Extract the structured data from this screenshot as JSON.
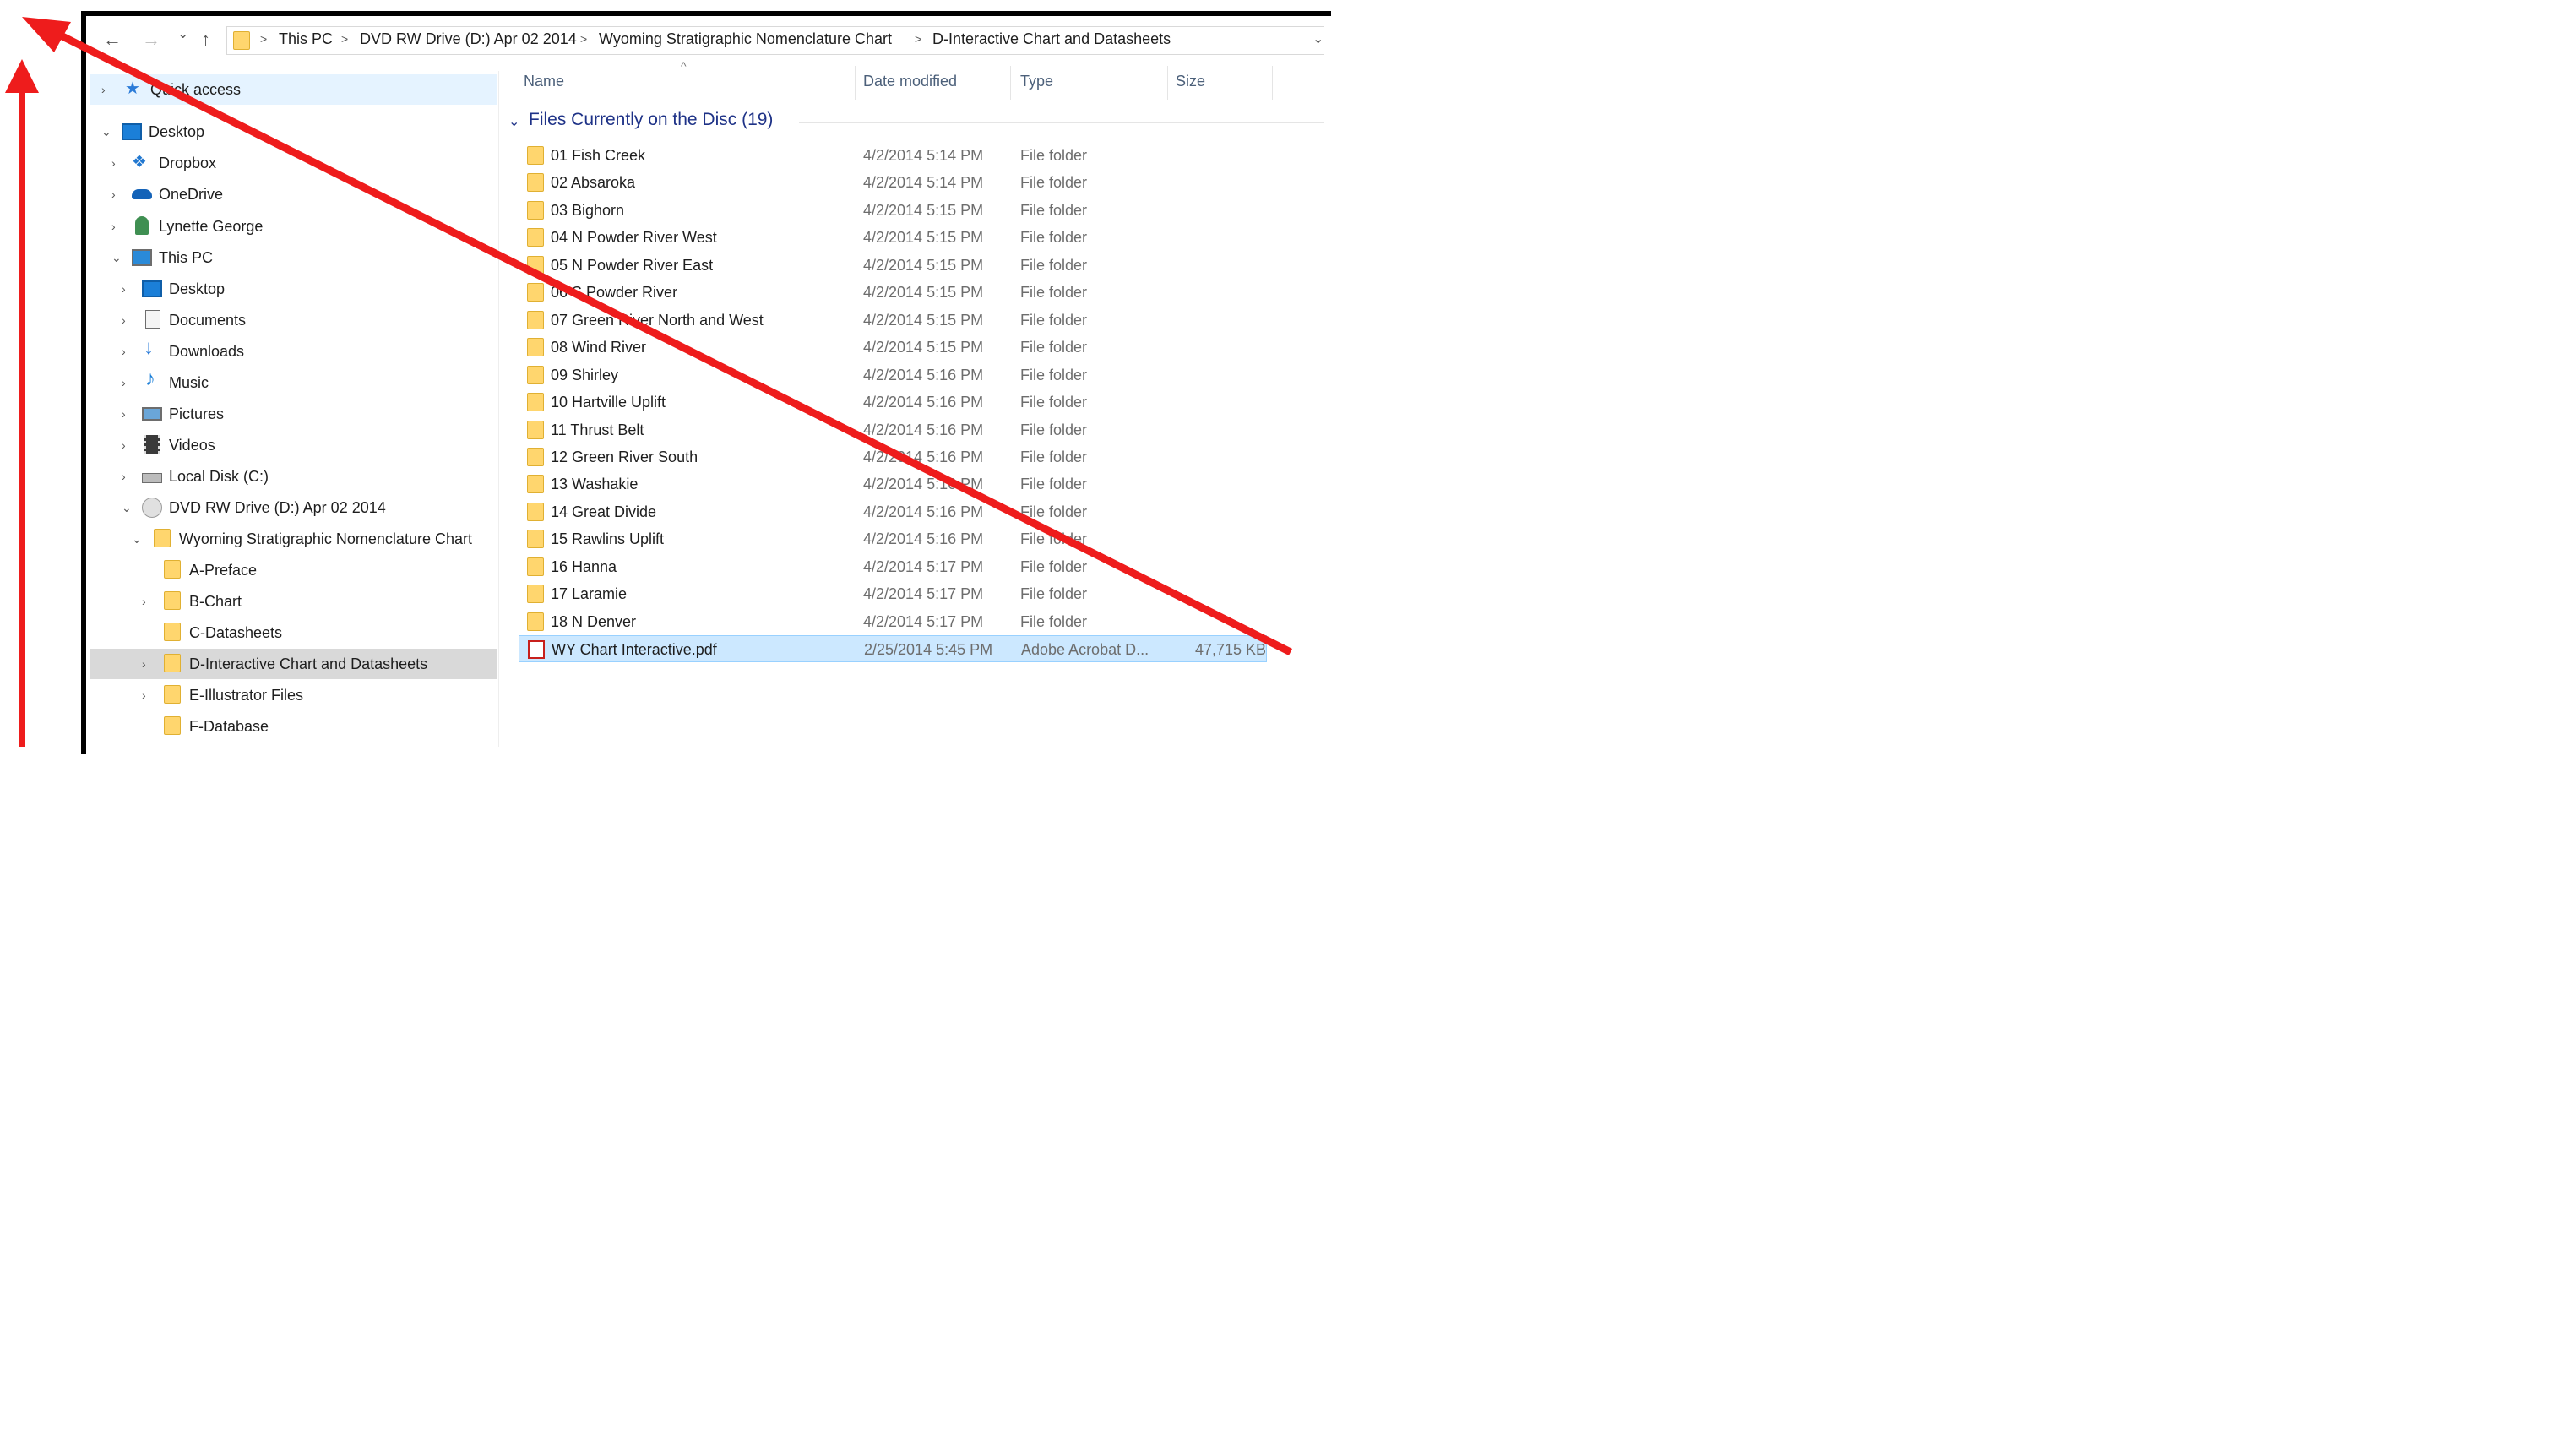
{
  "nav": {
    "back_icon": "←",
    "forward_icon": "→",
    "recent_icon": "⌄",
    "up_icon": "↑",
    "breadcrumb": [
      "This PC",
      "DVD RW Drive (D:) Apr 02 2014",
      "Wyoming Stratigraphic Nomenclature Chart",
      "D-Interactive Chart and Datasheets"
    ],
    "separator": ">",
    "address_dropdown_icon": "⌄"
  },
  "sidebar": {
    "items": [
      {
        "label": "Quick access",
        "icon": "star-icon",
        "chevron": "›"
      },
      {
        "label": "Desktop",
        "icon": "desktop-icon",
        "chevron": "⌄"
      },
      {
        "label": "Dropbox",
        "icon": "dropbox-icon",
        "chevron": "›"
      },
      {
        "label": "OneDrive",
        "icon": "onedrive-icon",
        "chevron": "›"
      },
      {
        "label": "Lynette George",
        "icon": "user-icon",
        "chevron": "›"
      },
      {
        "label": "This PC",
        "icon": "this-pc-icon",
        "chevron": "⌄"
      },
      {
        "label": "Desktop",
        "icon": "desktop-icon",
        "chevron": "›"
      },
      {
        "label": "Documents",
        "icon": "documents-icon",
        "chevron": "›"
      },
      {
        "label": "Downloads",
        "icon": "downloads-icon",
        "chevron": "›"
      },
      {
        "label": "Music",
        "icon": "music-icon",
        "chevron": "›"
      },
      {
        "label": "Pictures",
        "icon": "pictures-icon",
        "chevron": "›"
      },
      {
        "label": "Videos",
        "icon": "videos-icon",
        "chevron": "›"
      },
      {
        "label": "Local Disk (C:)",
        "icon": "local-disk-icon",
        "chevron": "›"
      },
      {
        "label": "DVD RW Drive (D:) Apr 02 2014",
        "icon": "dvd-drive-icon",
        "chevron": "⌄"
      },
      {
        "label": "Wyoming Stratigraphic Nomenclature Chart",
        "icon": "folder-icon",
        "chevron": "⌄"
      },
      {
        "label": "A-Preface",
        "icon": "folder-icon",
        "chevron": ""
      },
      {
        "label": "B-Chart",
        "icon": "folder-icon",
        "chevron": "›"
      },
      {
        "label": "C-Datasheets",
        "icon": "folder-icon",
        "chevron": ""
      },
      {
        "label": "D-Interactive Chart and Datasheets",
        "icon": "folder-icon",
        "chevron": "›"
      },
      {
        "label": "E-Illustrator Files",
        "icon": "folder-icon",
        "chevron": "›"
      },
      {
        "label": "F-Database",
        "icon": "folder-icon",
        "chevron": ""
      }
    ]
  },
  "columns": {
    "name": "Name",
    "date": "Date modified",
    "type": "Type",
    "size": "Size",
    "sort_icon": "^"
  },
  "group": {
    "label": "Files Currently on the Disc (19)",
    "chevron": "⌄"
  },
  "files": [
    {
      "name": "01 Fish Creek",
      "date": "4/2/2014 5:14 PM",
      "type": "File folder",
      "size": ""
    },
    {
      "name": "02 Absaroka",
      "date": "4/2/2014 5:14 PM",
      "type": "File folder",
      "size": ""
    },
    {
      "name": "03 Bighorn",
      "date": "4/2/2014 5:15 PM",
      "type": "File folder",
      "size": ""
    },
    {
      "name": "04 N Powder River West",
      "date": "4/2/2014 5:15 PM",
      "type": "File folder",
      "size": ""
    },
    {
      "name": "05 N Powder River East",
      "date": "4/2/2014 5:15 PM",
      "type": "File folder",
      "size": ""
    },
    {
      "name": "06 S Powder River",
      "date": "4/2/2014 5:15 PM",
      "type": "File folder",
      "size": ""
    },
    {
      "name": "07 Green River North and West",
      "date": "4/2/2014 5:15 PM",
      "type": "File folder",
      "size": ""
    },
    {
      "name": "08 Wind River",
      "date": "4/2/2014 5:15 PM",
      "type": "File folder",
      "size": ""
    },
    {
      "name": "09 Shirley",
      "date": "4/2/2014 5:16 PM",
      "type": "File folder",
      "size": ""
    },
    {
      "name": "10 Hartville Uplift",
      "date": "4/2/2014 5:16 PM",
      "type": "File folder",
      "size": ""
    },
    {
      "name": "11 Thrust Belt",
      "date": "4/2/2014 5:16 PM",
      "type": "File folder",
      "size": ""
    },
    {
      "name": "12 Green River South",
      "date": "4/2/2014 5:16 PM",
      "type": "File folder",
      "size": ""
    },
    {
      "name": "13 Washakie",
      "date": "4/2/2014 5:16 PM",
      "type": "File folder",
      "size": ""
    },
    {
      "name": "14 Great Divide",
      "date": "4/2/2014 5:16 PM",
      "type": "File folder",
      "size": ""
    },
    {
      "name": "15 Rawlins Uplift",
      "date": "4/2/2014 5:16 PM",
      "type": "File folder",
      "size": ""
    },
    {
      "name": "16 Hanna",
      "date": "4/2/2014 5:17 PM",
      "type": "File folder",
      "size": ""
    },
    {
      "name": "17 Laramie",
      "date": "4/2/2014 5:17 PM",
      "type": "File folder",
      "size": ""
    },
    {
      "name": "18 N Denver",
      "date": "4/2/2014 5:17 PM",
      "type": "File folder",
      "size": ""
    },
    {
      "name": "WY Chart Interactive.pdf",
      "date": "2/25/2014 5:45 PM",
      "type": "Adobe Acrobat D...",
      "size": "47,715 KB"
    }
  ],
  "colors": {
    "annotation_arrow": "#ee1c1c",
    "selection": "#cce8ff",
    "folder": "#ffd66e",
    "group_header": "#1e3287"
  }
}
